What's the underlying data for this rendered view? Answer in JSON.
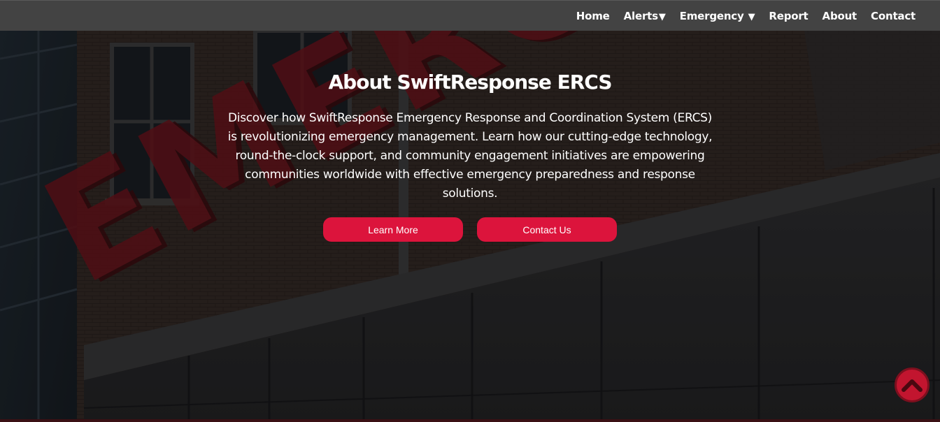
{
  "nav": {
    "items": [
      {
        "label": "Home",
        "caret": ""
      },
      {
        "label": "Alerts",
        "caret": "▼"
      },
      {
        "label": "Emergency",
        "caret": "▼"
      },
      {
        "label": "Report",
        "caret": ""
      },
      {
        "label": "About",
        "caret": ""
      },
      {
        "label": "Contact",
        "caret": ""
      }
    ]
  },
  "hero": {
    "title": "About SwiftResponse ERCS",
    "description": "Discover how SwiftResponse Emergency Response and Coordination System (ERCS) is revolutionizing emergency management. Learn how our cutting-edge technology, round-the-clock support, and community engagement initiatives are empowering communities worldwide with effective emergency preparedness and response solutions.",
    "background_sign_text": "EMERGENCY",
    "buttons": {
      "learn_more": "Learn More",
      "contact_us": "Contact Us"
    }
  },
  "scroll_top": {
    "icon": "chevron-up-icon"
  },
  "colors": {
    "accent": "#dc143c",
    "navbar": "#434343",
    "text": "#ffffff"
  }
}
